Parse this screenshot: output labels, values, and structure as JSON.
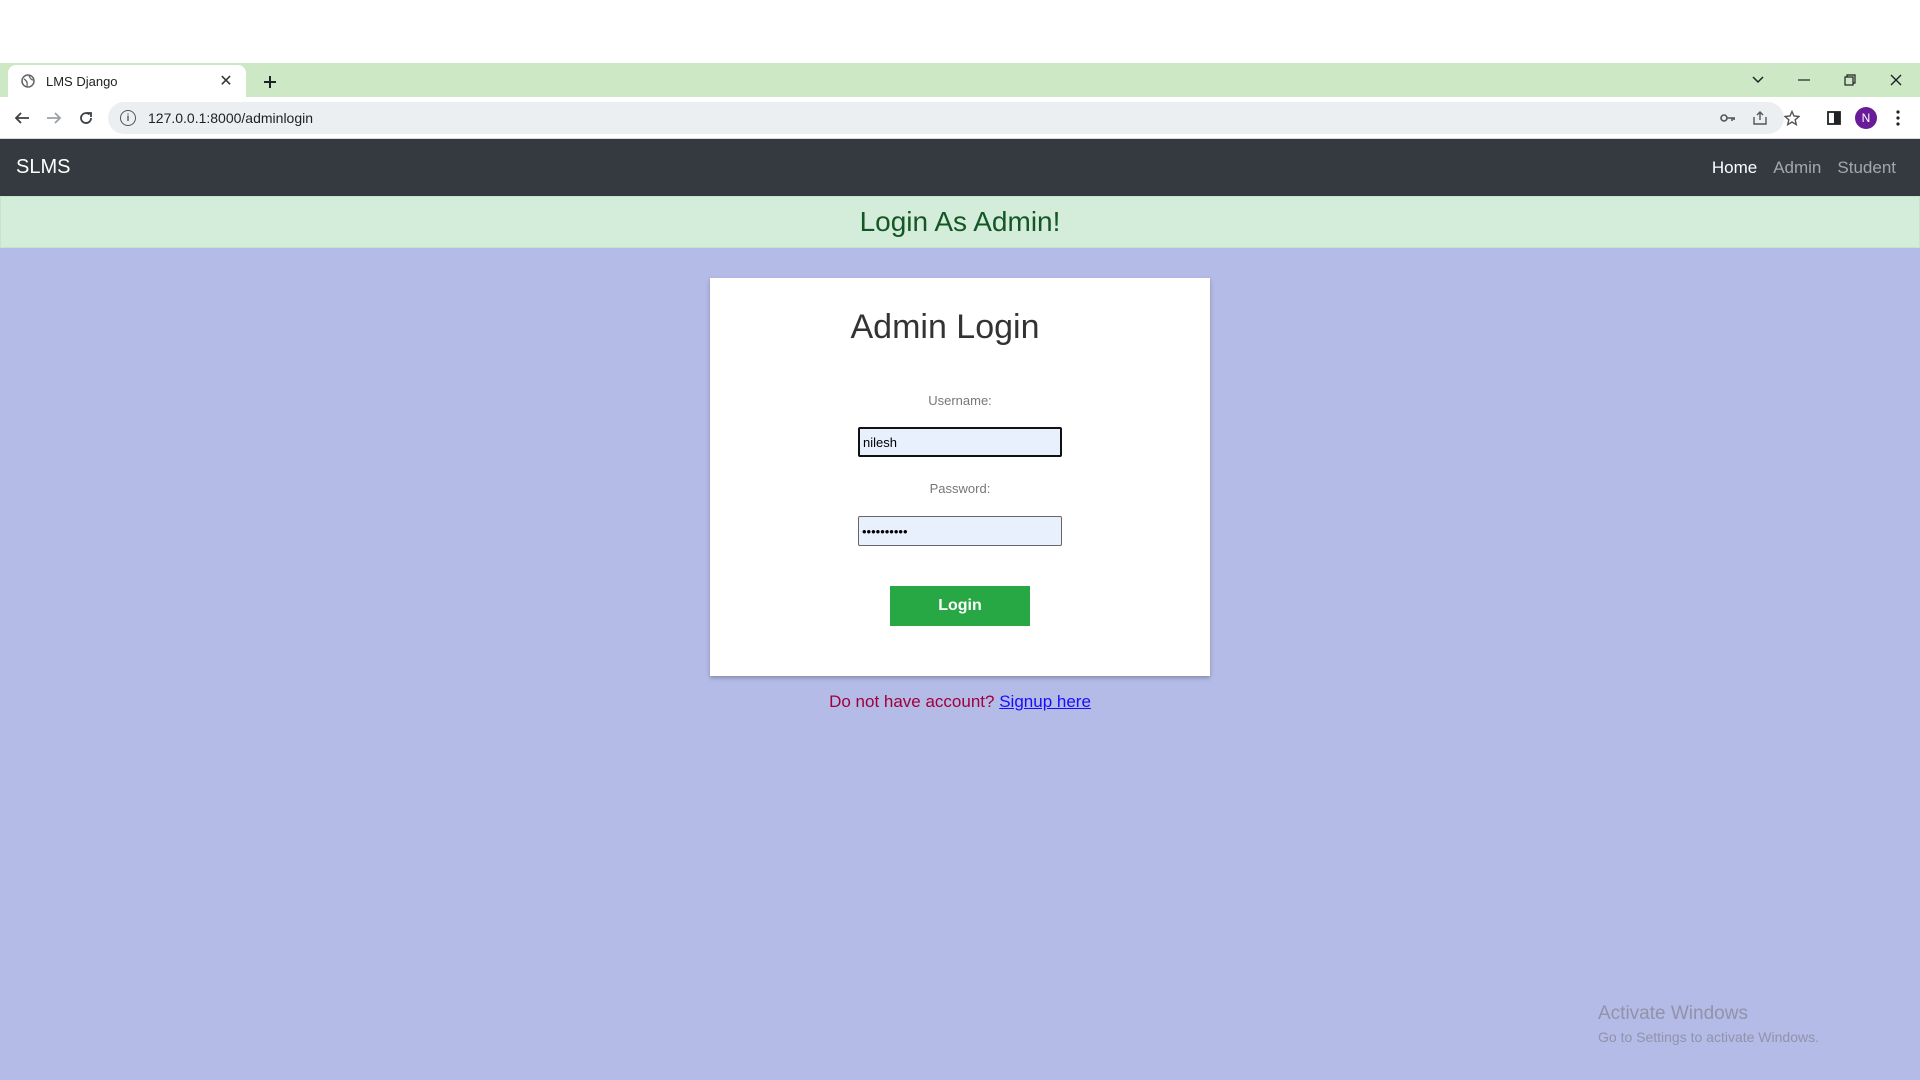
{
  "browser": {
    "tab_title": "LMS Django",
    "url": "127.0.0.1:8000/adminlogin",
    "profile_initial": "N"
  },
  "navbar": {
    "brand": "SLMS",
    "links": [
      "Home",
      "Admin",
      "Student"
    ],
    "active": "Home"
  },
  "alert": {
    "message": "Login As Admin!"
  },
  "login_card": {
    "title": "Admin Login",
    "username_label": "Username:",
    "username_value": "nilesh",
    "password_label": "Password:",
    "password_value": "••••••••••",
    "submit_label": "Login"
  },
  "signup": {
    "prompt": "Do not have account?",
    "link_text": "Signup here"
  },
  "watermark": {
    "title": "Activate Windows",
    "subtitle": "Go to Settings to activate Windows."
  },
  "colors": {
    "page_bg": "#b4bbe6",
    "navbar_bg": "#343a40",
    "alert_bg": "#d4edda",
    "button_bg": "#28a745",
    "tabstrip_bg": "#cde8c5"
  }
}
